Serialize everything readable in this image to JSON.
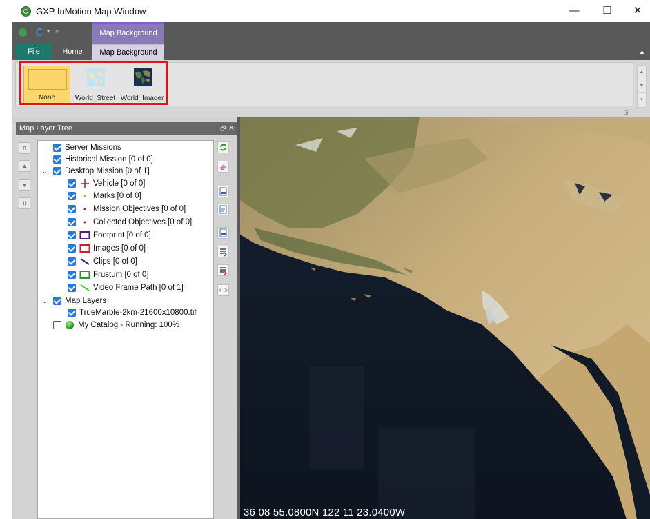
{
  "window": {
    "title": "GXP InMotion Map Window",
    "minimize": "—",
    "maximize": "☐",
    "close": "✕"
  },
  "ribbon": {
    "contextual_header": "Map Background",
    "tabs": [
      {
        "label": "File"
      },
      {
        "label": "Home"
      },
      {
        "label": "Map Background"
      }
    ],
    "collapse_glyph": "▲",
    "help_glyph": "?",
    "gallery": [
      {
        "label": "None",
        "icon": "none-swatch",
        "selected": true
      },
      {
        "label": "World_Street",
        "icon": "world-street-thumbnail"
      },
      {
        "label": "World_Imager",
        "icon": "world-imagery-thumbnail"
      }
    ]
  },
  "layer_panel": {
    "title": "Map Layer Tree",
    "pin_glyph": "🗗",
    "close_glyph": "✕",
    "tree": [
      {
        "label": "Server Missions",
        "checked": true,
        "level": 0
      },
      {
        "label": "Historical Mission [0 of 0]",
        "checked": true,
        "level": 0
      },
      {
        "label": "Desktop Mission [0 of 1]",
        "checked": true,
        "level": 0,
        "expanded": true
      },
      {
        "label": "Vehicle [0 of 0]",
        "checked": true,
        "level": 1,
        "symbol": "vehicle-cross-icon"
      },
      {
        "label": "Marks [0 of 0]",
        "checked": true,
        "level": 1,
        "symbol": "mark-dot-icon"
      },
      {
        "label": "Mission Objectives [0 of 0]",
        "checked": true,
        "level": 1,
        "symbol": "objective-dot-icon"
      },
      {
        "label": "Collected Objectives [0 of 0]",
        "checked": true,
        "level": 1,
        "symbol": "collected-dot-icon"
      },
      {
        "label": "Footprint [0 of 0]",
        "checked": true,
        "level": 1,
        "symbol": "footprint-rect-icon"
      },
      {
        "label": "Images [0 of 0]",
        "checked": true,
        "level": 1,
        "symbol": "images-rect-icon"
      },
      {
        "label": "Clips [0 of 0]",
        "checked": true,
        "level": 1,
        "symbol": "clips-line-icon"
      },
      {
        "label": "Frustum [0 of 0]",
        "checked": true,
        "level": 1,
        "symbol": "frustum-rect-icon"
      },
      {
        "label": "Video Frame Path [0 of 1]",
        "checked": true,
        "level": 1,
        "symbol": "video-path-line-icon"
      },
      {
        "label": "Map Layers",
        "checked": true,
        "level": 0,
        "expanded": true
      },
      {
        "label": "TrueMarble-2km-21600x10800.tif",
        "checked": true,
        "level": 1
      },
      {
        "label": "My Catalog - Running: 100%",
        "checked": false,
        "level": 0,
        "symbol": "status-green-icon"
      }
    ]
  },
  "map": {
    "coordinate_readout": "36 08 55.0800N 122 11 23.0400W"
  },
  "colors": {
    "title_bar": "#ffffff",
    "ribbon_dark": "#595959",
    "contextual_tab": "#8a7bb8",
    "file_tab": "#1b7a6b",
    "selected_gallery": "#fcd76b",
    "highlight_box": "#e0141a",
    "checkbox": "#2d7ad6"
  }
}
